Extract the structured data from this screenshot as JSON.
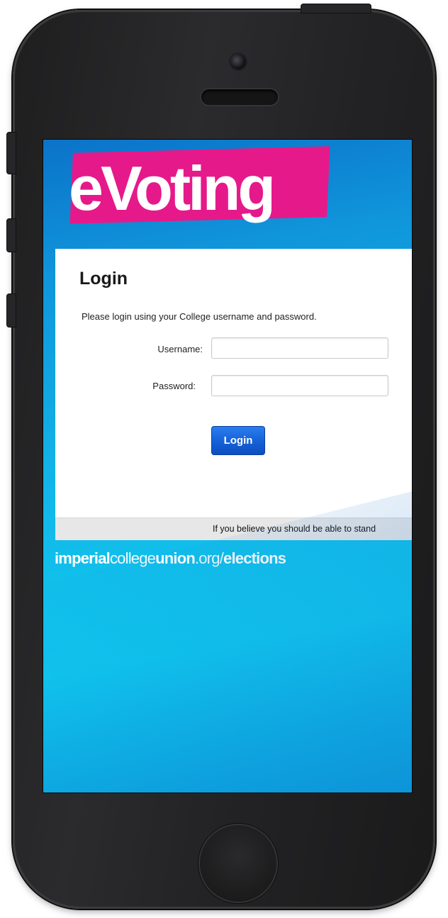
{
  "brand": {
    "logo_text": "eVoting",
    "logo_color": "#e6198b"
  },
  "login": {
    "title": "Login",
    "description": "Please login using your College username and password.",
    "username_label": "Username:",
    "username_value": "",
    "password_label": "Password:",
    "password_value": "",
    "submit_label": "Login"
  },
  "footer": {
    "text": "If you believe you should be able to stand"
  },
  "url": {
    "part1": "imperial",
    "part2": "college",
    "part3": "union",
    "part4": ".org/",
    "part5": "elections"
  },
  "colors": {
    "accent_blue": "#1460d6",
    "screen_background": "#12b7e8"
  }
}
